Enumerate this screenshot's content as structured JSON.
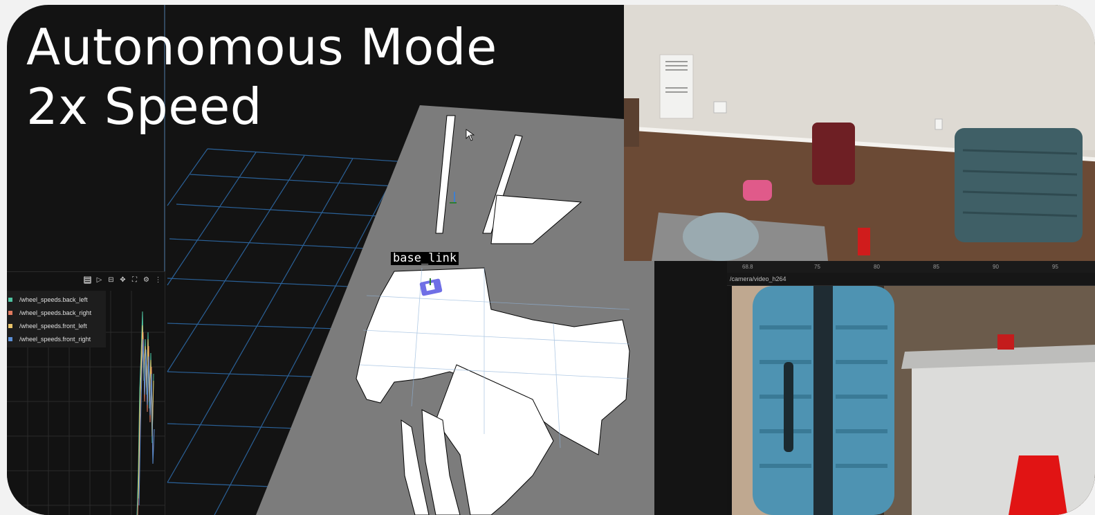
{
  "overlay": {
    "title_line1": "Autonomous Mode",
    "title_line2": "2x Speed"
  },
  "map": {
    "frame_label": "base_link"
  },
  "plot_panel": {
    "toolbar_icons": [
      "list-icon",
      "play-icon",
      "settings-sliders-icon",
      "move-icon",
      "fullscreen-icon",
      "gear-icon",
      "more-icon"
    ],
    "legend": [
      {
        "label": "/wheel_speeds.back_left",
        "color": "#4fc3a1"
      },
      {
        "label": "/wheel_speeds.back_right",
        "color": "#e07a5f"
      },
      {
        "label": "/wheel_speeds.front_left",
        "color": "#e9c46a"
      },
      {
        "label": "/wheel_speeds.front_right",
        "color": "#5b8fd6"
      }
    ]
  },
  "timeline": {
    "ticks": [
      "68.8",
      "75",
      "80",
      "85",
      "90",
      "95"
    ]
  },
  "camera_panel": {
    "topic": "/camera/video_h264"
  }
}
